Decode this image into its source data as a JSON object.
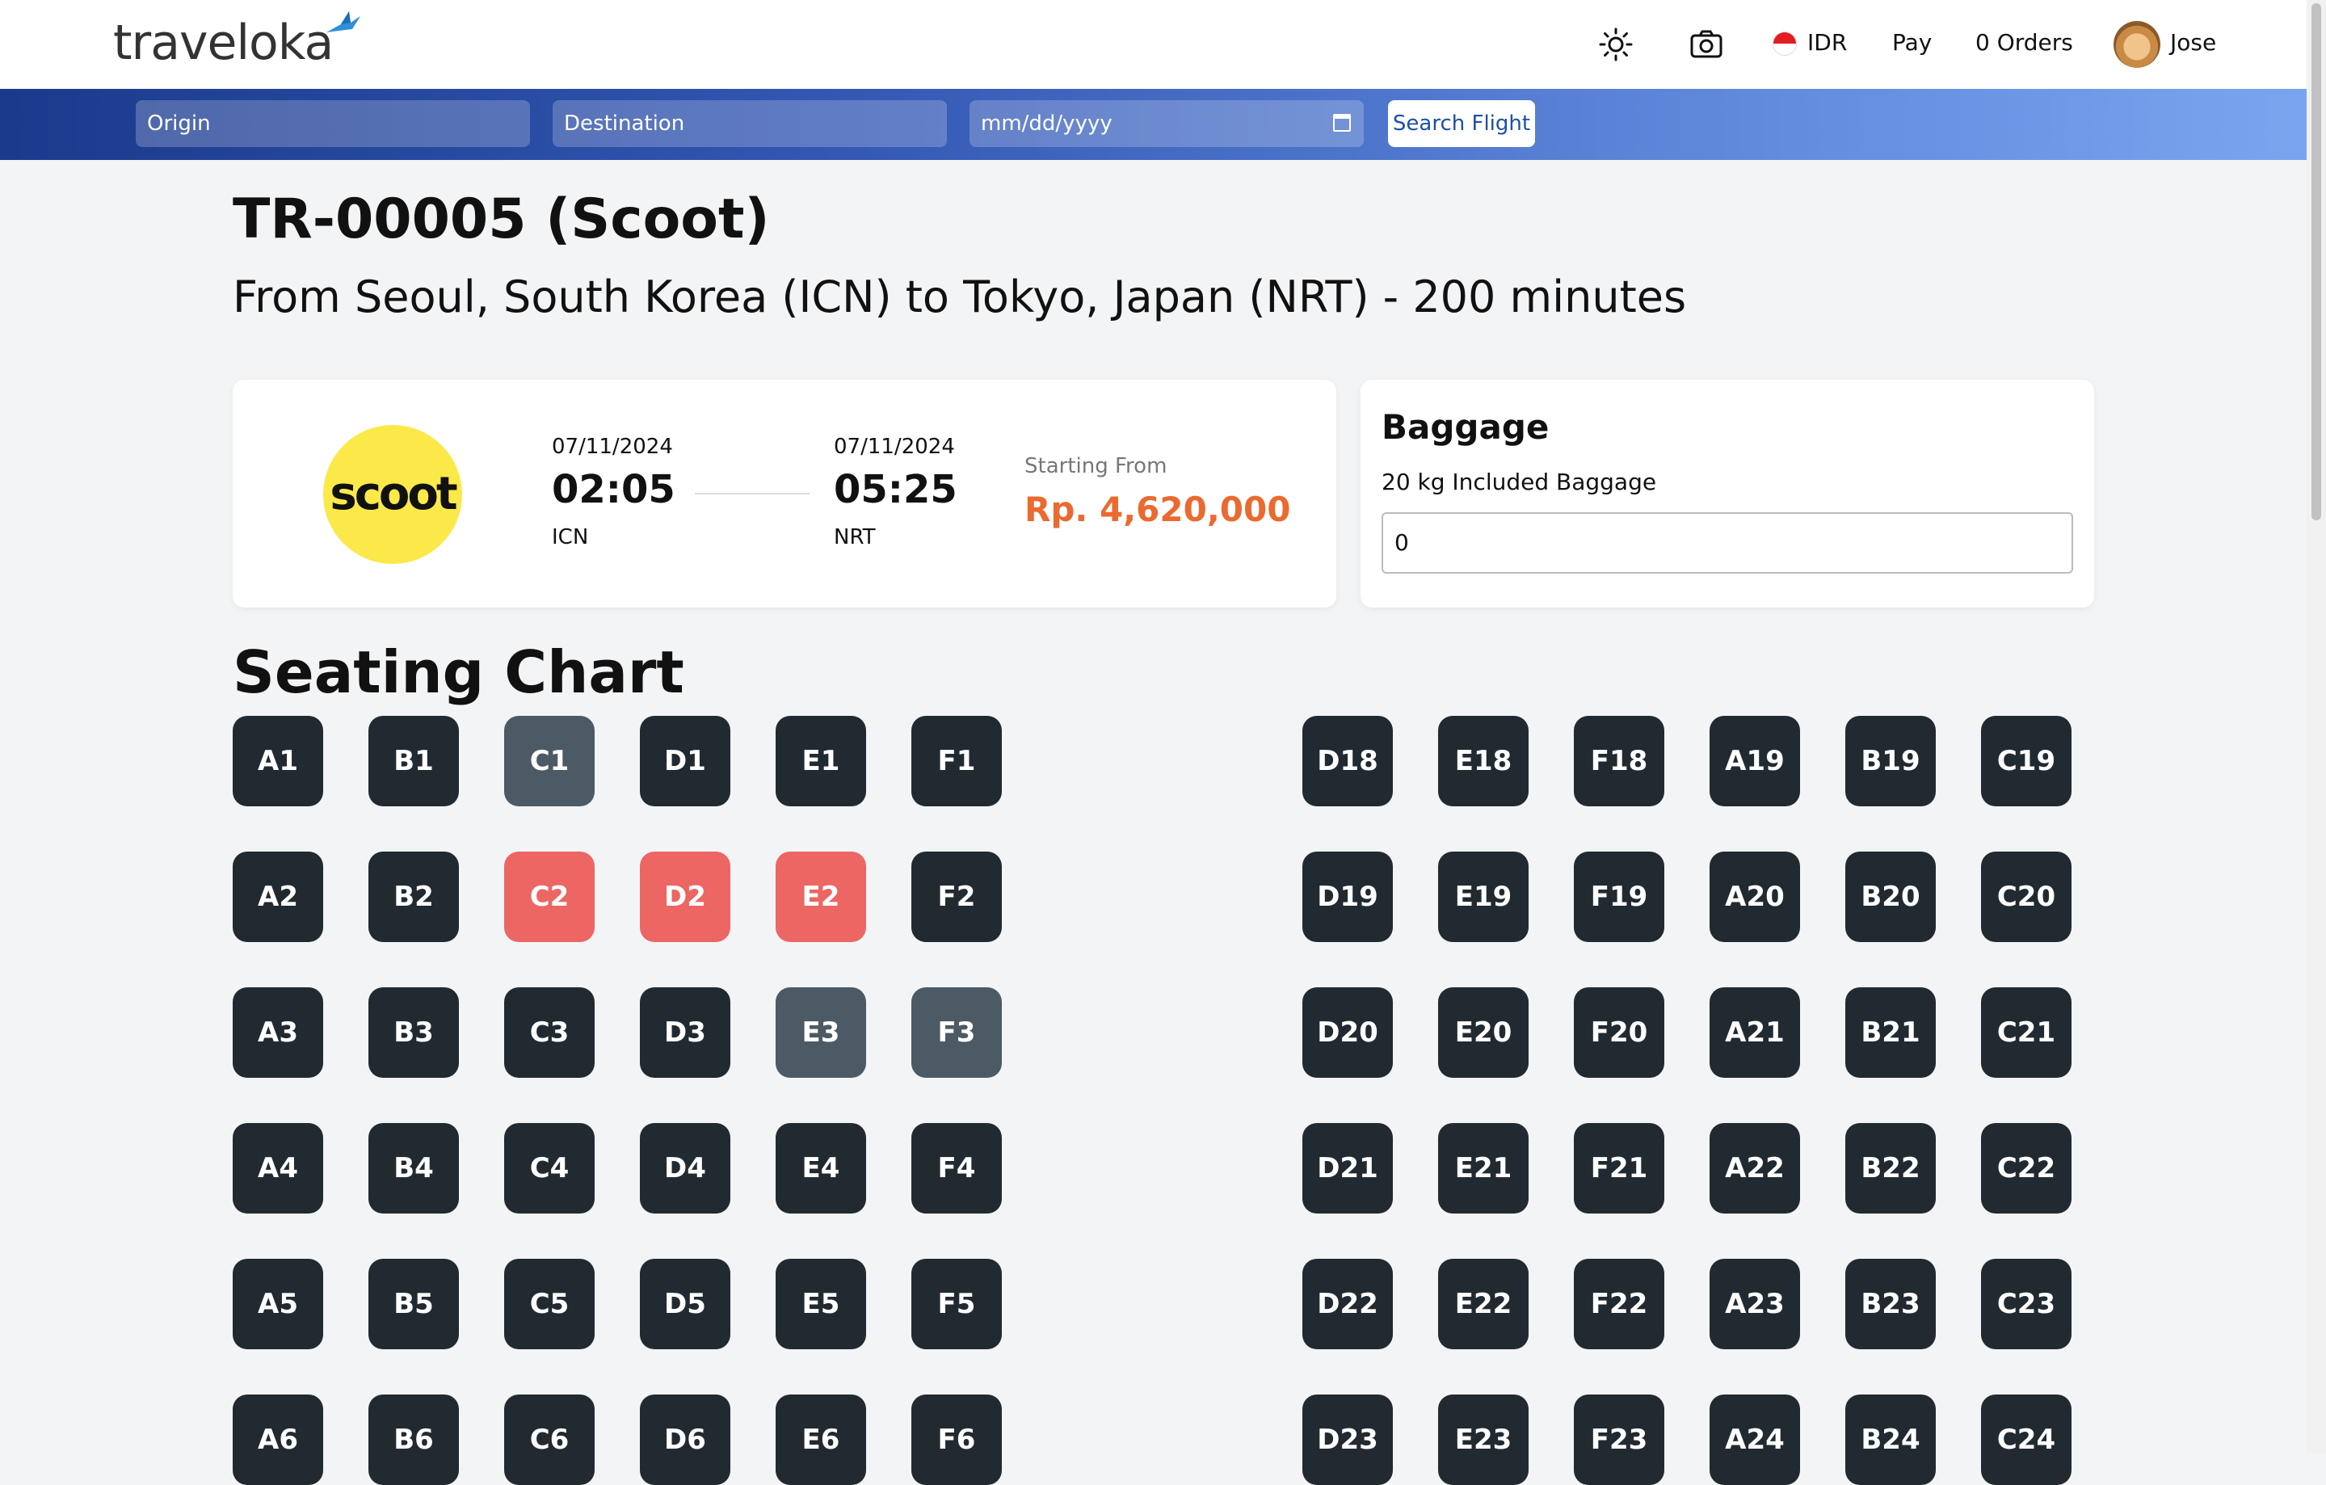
{
  "nav": {
    "logo": "traveloka",
    "currency": "IDR",
    "pay": "Pay",
    "orders": "0 Orders",
    "user": "Jose",
    "icons": [
      "sun-icon",
      "camera-icon",
      "indonesia-flag-icon"
    ]
  },
  "search": {
    "origin_placeholder": "Origin",
    "destination_placeholder": "Destination",
    "date_placeholder": "mm/dd/yyyy",
    "button": "Search Flight"
  },
  "flight": {
    "title": "TR-00005 (Scoot)",
    "subtitle": "From Seoul, South Korea (ICN) to Tokyo, Japan (NRT) - 200 minutes",
    "airline_logo": "scoot",
    "departure": {
      "date": "07/11/2024",
      "time": "02:05",
      "airport": "ICN"
    },
    "arrival": {
      "date": "07/11/2024",
      "time": "05:25",
      "airport": "NRT"
    },
    "price_label": "Starting From",
    "price": "Rp. 4,620,000"
  },
  "baggage": {
    "title": "Baggage",
    "included": "20 kg Included Baggage",
    "value": "0"
  },
  "seating": {
    "title": "Seating Chart",
    "left_block": [
      [
        "A1",
        "B1",
        "C1",
        "D1",
        "E1",
        "F1"
      ],
      [
        "A2",
        "B2",
        "C2",
        "D2",
        "E2",
        "F2"
      ],
      [
        "A3",
        "B3",
        "C3",
        "D3",
        "E3",
        "F3"
      ],
      [
        "A4",
        "B4",
        "C4",
        "D4",
        "E4",
        "F4"
      ],
      [
        "A5",
        "B5",
        "C5",
        "D5",
        "E5",
        "F5"
      ],
      [
        "A6",
        "B6",
        "C6",
        "D6",
        "E6",
        "F6"
      ]
    ],
    "right_block": [
      [
        "D18",
        "E18",
        "F18",
        "A19",
        "B19",
        "C19"
      ],
      [
        "D19",
        "E19",
        "F19",
        "A20",
        "B20",
        "C20"
      ],
      [
        "D20",
        "E20",
        "F20",
        "A21",
        "B21",
        "C21"
      ],
      [
        "D21",
        "E21",
        "F21",
        "A22",
        "B22",
        "C22"
      ],
      [
        "D22",
        "E22",
        "F22",
        "A23",
        "B23",
        "C23"
      ],
      [
        "D23",
        "E23",
        "F23",
        "A24",
        "B24",
        "C24"
      ]
    ],
    "booked": [
      "C2",
      "D2",
      "E2"
    ],
    "selected": [
      "C1",
      "E3",
      "F3"
    ],
    "colors": {
      "available": "#222a31",
      "selected": "#4b5a64",
      "booked": "#ec6664"
    }
  }
}
